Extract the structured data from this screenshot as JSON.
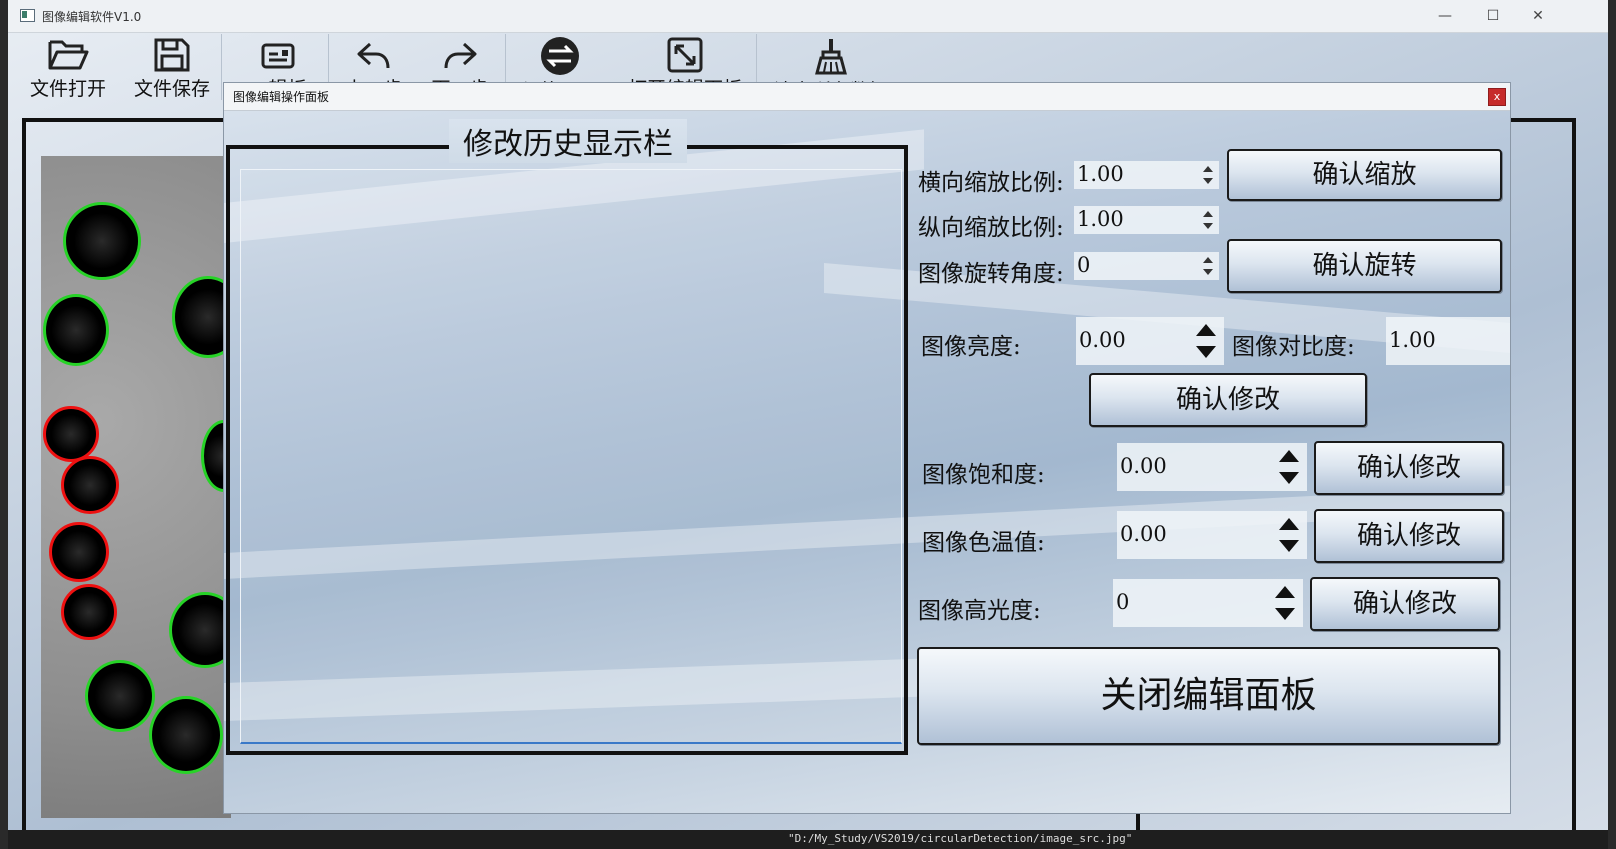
{
  "window": {
    "title": "图像编辑软件V1.0",
    "minimize_glyph": "—",
    "maximize_glyph": "☐",
    "close_glyph": "✕"
  },
  "toolbar": {
    "items": [
      {
        "label": "文件打开",
        "icon": "folder-open-icon"
      },
      {
        "label": "文件保存",
        "icon": "save-icon"
      },
      {
        "label": "…辑板",
        "icon": "edit-card-icon"
      },
      {
        "label": "上一步",
        "icon": "undo-icon"
      },
      {
        "label": "下一步",
        "icon": "redo-icon"
      },
      {
        "label": "切换显示",
        "icon": "swap-icon"
      },
      {
        "label": "打开编辑面板",
        "icon": "resize-icon"
      },
      {
        "label": "清空所有数据",
        "icon": "broom-icon"
      }
    ]
  },
  "dialog": {
    "title": "图像编辑操作面板",
    "close_label": "x",
    "history_title": "修改历史显示栏",
    "close_panel_label": "关闭编辑面板"
  },
  "controls": {
    "h_scale_label": "横向缩放比例:",
    "h_scale_value": "1.00",
    "v_scale_label": "纵向缩放比例:",
    "v_scale_value": "1.00",
    "confirm_scale": "确认缩放",
    "rotate_label": "图像旋转角度:",
    "rotate_value": "0",
    "confirm_rotate": "确认旋转",
    "brightness_label": "图像亮度:",
    "brightness_value": "0.00",
    "contrast_label": "图像对比度:",
    "contrast_value": "1.00",
    "confirm_modify": "确认修改",
    "saturation_label": "图像饱和度:",
    "saturation_value": "0.00",
    "temperature_label": "图像色温值:",
    "temperature_value": "0.00",
    "highlight_label": "图像高光度:",
    "highlight_value": "0"
  },
  "status": {
    "path": "\"D:/My_Study/VS2019/circularDetection/image_src.jpg\""
  },
  "colors": {
    "accent_green": "#27d327",
    "accent_red": "#e11111",
    "dialog_close": "#c62b2b"
  }
}
